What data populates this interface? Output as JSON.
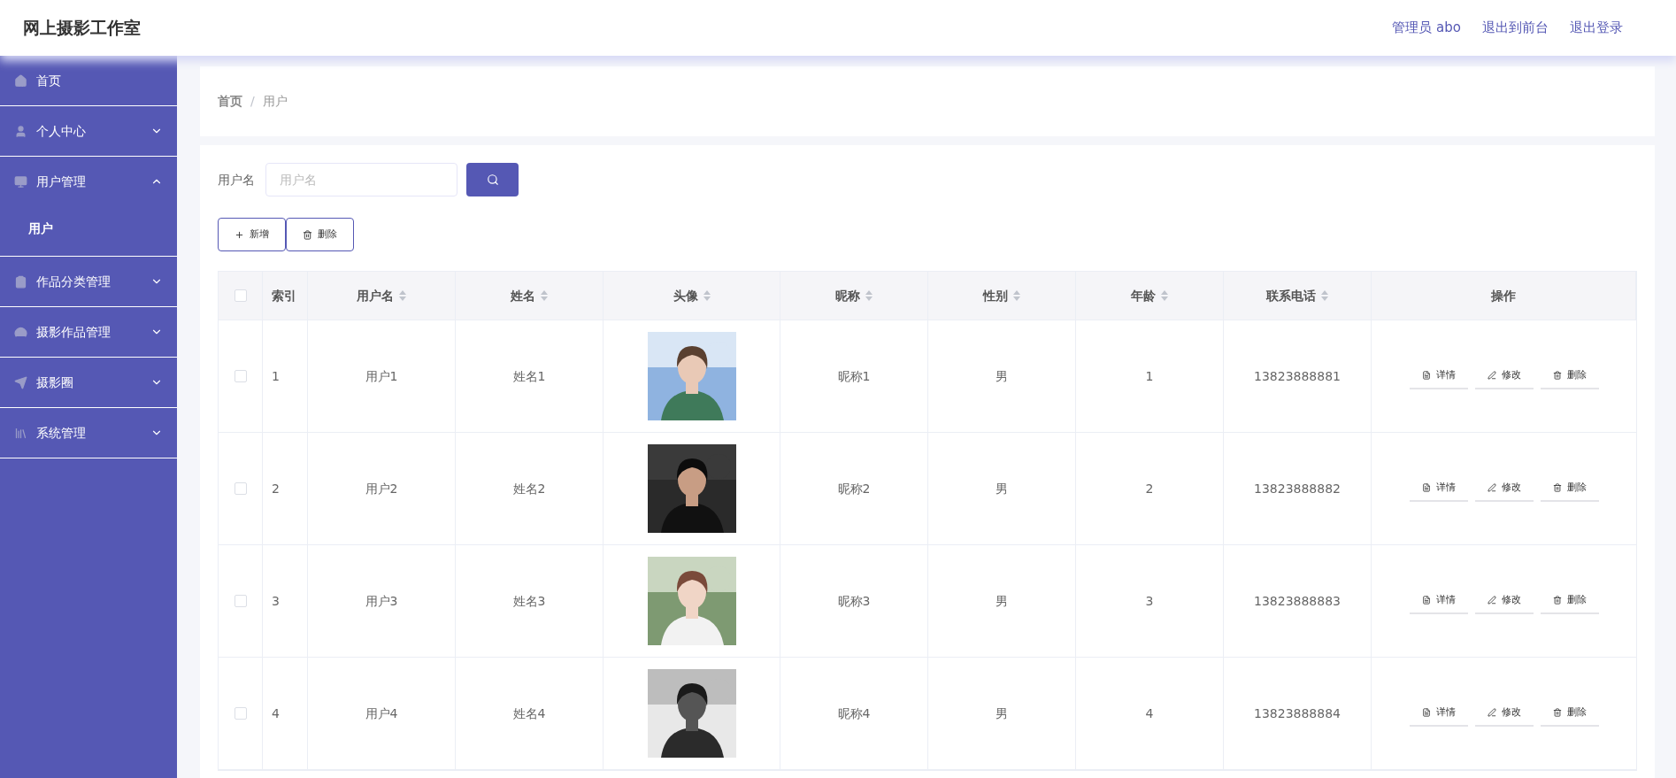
{
  "header": {
    "title": "网上摄影工作室",
    "links": [
      "管理员 abo",
      "退出到前台",
      "退出登录"
    ]
  },
  "sidebar": {
    "items": [
      {
        "label": "首页",
        "kind": "link"
      },
      {
        "label": "个人中心",
        "kind": "menu",
        "expanded": false
      },
      {
        "label": "用户管理",
        "kind": "menu",
        "expanded": true,
        "children": [
          {
            "label": "用户"
          }
        ]
      },
      {
        "label": "作品分类管理",
        "kind": "menu",
        "expanded": false
      },
      {
        "label": "摄影作品管理",
        "kind": "menu",
        "expanded": false
      },
      {
        "label": "摄影圈",
        "kind": "menu",
        "expanded": false
      },
      {
        "label": "系统管理",
        "kind": "menu",
        "expanded": false
      }
    ]
  },
  "breadcrumb": [
    "首页",
    "/",
    "用户"
  ],
  "search": {
    "label": "用户名",
    "placeholder": "用户名"
  },
  "toolbar": {
    "buttons": [
      "新增",
      "删除"
    ]
  },
  "table": {
    "select_all": {
      "checked": false
    },
    "columns": [
      {
        "label": "索引",
        "sortable": false
      },
      {
        "label": "用户名",
        "sortable": true
      },
      {
        "label": "姓名",
        "sortable": true
      },
      {
        "label": "头像",
        "sortable": true
      },
      {
        "label": "昵称",
        "sortable": true
      },
      {
        "label": "性别",
        "sortable": true
      },
      {
        "label": "年龄",
        "sortable": true
      },
      {
        "label": "联系电话",
        "sortable": true
      },
      {
        "label": "操作",
        "sortable": false
      }
    ],
    "rows": [
      {
        "checked": false,
        "index": "1",
        "username": "用户1",
        "name": "姓名1",
        "avatar": {
          "kind": "picture"
        },
        "nickname": "昵称1",
        "gender": "男",
        "age": "1",
        "phone": "13823888881",
        "actions": [
          "详情",
          "修改",
          "删除"
        ]
      },
      {
        "checked": false,
        "index": "2",
        "username": "用户2",
        "name": "姓名2",
        "avatar": {
          "kind": "picture"
        },
        "nickname": "昵称2",
        "gender": "男",
        "age": "2",
        "phone": "13823888882",
        "actions": [
          "详情",
          "修改",
          "删除"
        ]
      },
      {
        "checked": false,
        "index": "3",
        "username": "用户3",
        "name": "姓名3",
        "avatar": {
          "kind": "picture"
        },
        "nickname": "昵称3",
        "gender": "男",
        "age": "3",
        "phone": "13823888883",
        "actions": [
          "详情",
          "修改",
          "删除"
        ]
      },
      {
        "checked": false,
        "index": "4",
        "username": "用户4",
        "name": "姓名4",
        "avatar": {
          "kind": "picture"
        },
        "nickname": "昵称4",
        "gender": "男",
        "age": "4",
        "phone": "13823888884",
        "actions": [
          "详情",
          "修改",
          "删除"
        ]
      }
    ]
  }
}
